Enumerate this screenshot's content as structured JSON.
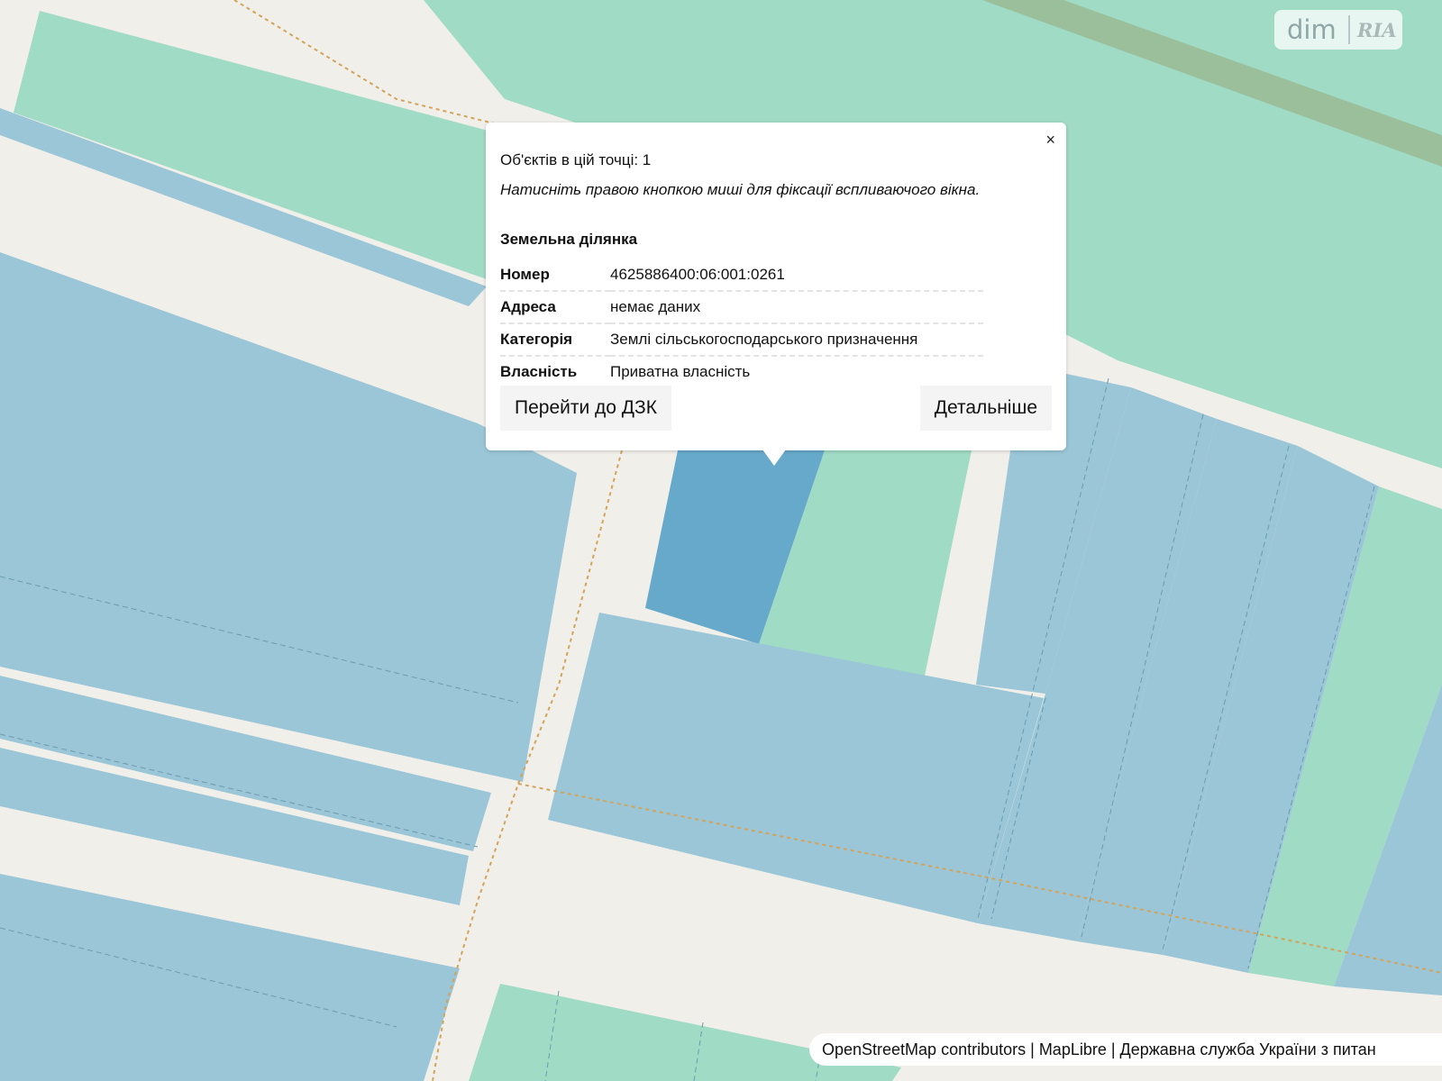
{
  "map": {
    "colors": {
      "background": "#f1efea",
      "parcel": "#9ac6d7",
      "parcel_selected": "#67a9ca",
      "green_area": "#a0dbc5",
      "green_strip": "#9bbf9b",
      "dashed_boundary": "#d2a45b"
    }
  },
  "popup": {
    "close_icon": "×",
    "objects_count": "Об'єктів в цій точці: 1",
    "hint": "Натисніть правою кнопкою миші для фіксації вспливаючого вікна.",
    "section_title": "Земельна ділянка",
    "rows": [
      {
        "key": "Номер",
        "value": "4625886400:06:001:0261"
      },
      {
        "key": "Адреса",
        "value": "немає даних"
      },
      {
        "key": "Категорія",
        "value": "Землі сільськогосподарського призначення"
      },
      {
        "key": "Власність",
        "value": "Приватна власність"
      }
    ],
    "go_to_dzk_label": "Перейти до ДЗК",
    "details_label": "Детальніше"
  },
  "attribution": {
    "osm": "OpenStreetMap contributors",
    "separator": " | ",
    "maplibre": "MapLibre",
    "agency": "Державна служба України з питан"
  },
  "watermark": {
    "dim": "dim",
    "ria": "RIA"
  }
}
